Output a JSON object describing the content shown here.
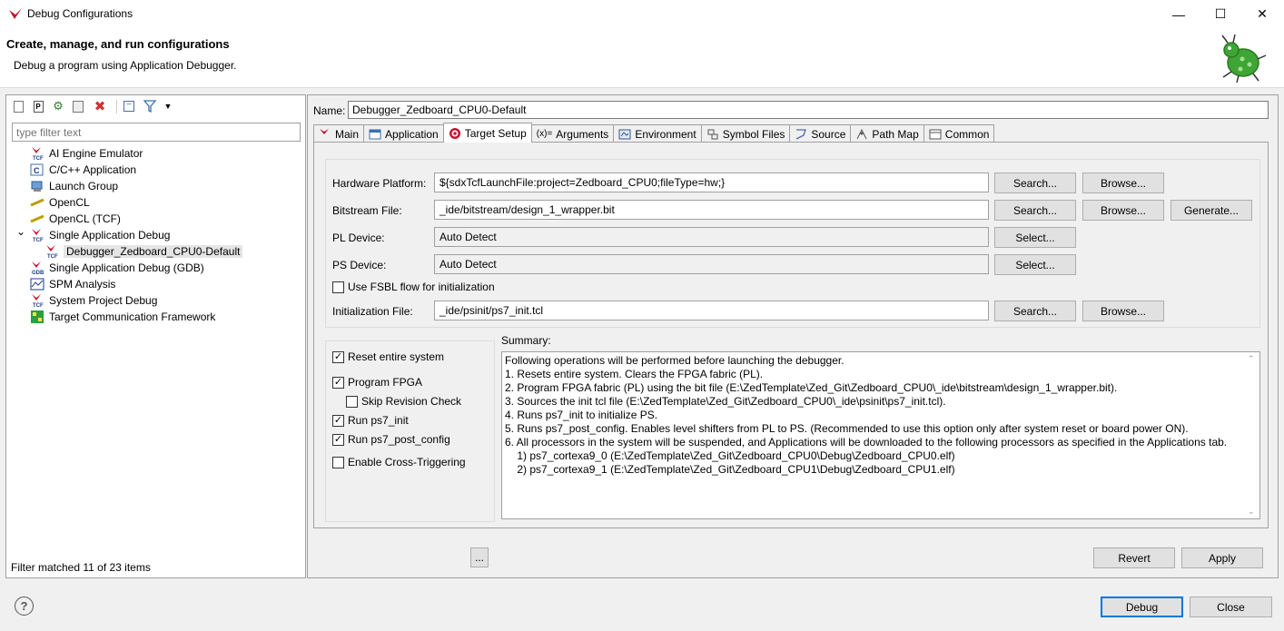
{
  "window": {
    "title": "Debug Configurations",
    "minimize_glyph": "—",
    "maximize_glyph": "☐",
    "close_glyph": "✕"
  },
  "header": {
    "title": "Create, manage, and run configurations",
    "subtitle": "Debug a program using Application Debugger."
  },
  "left": {
    "filter_placeholder": "type filter text",
    "toolbar_icons": [
      "new-config-icon",
      "new-prototype-icon",
      "export-icon",
      "duplicate-icon",
      "delete-icon",
      "collapse-all-icon",
      "filter-icon",
      "view-menu-icon"
    ],
    "tree": [
      {
        "label": "AI Engine Emulator",
        "icon": "tcf-icon",
        "indent": 0
      },
      {
        "label": "C/C++ Application",
        "icon": "c-app-icon",
        "indent": 0
      },
      {
        "label": "Launch Group",
        "icon": "launch-group-icon",
        "indent": 0
      },
      {
        "label": "OpenCL",
        "icon": "opencl-icon",
        "indent": 0
      },
      {
        "label": "OpenCL (TCF)",
        "icon": "opencl-tcf-icon",
        "indent": 0
      },
      {
        "label": "Single Application Debug",
        "icon": "tcf-icon",
        "indent": 0,
        "expanded": true
      },
      {
        "label": "Debugger_Zedboard_CPU0-Default",
        "icon": "tcf-icon",
        "indent": 1,
        "selected": true
      },
      {
        "label": "Single Application Debug (GDB)",
        "icon": "gdb-icon",
        "indent": 0
      },
      {
        "label": "SPM Analysis",
        "icon": "spm-icon",
        "indent": 0
      },
      {
        "label": "System Project Debug",
        "icon": "tcf-icon",
        "indent": 0
      },
      {
        "label": "Target Communication Framework",
        "icon": "tcf-framework-icon",
        "indent": 0
      }
    ],
    "status": "Filter matched 11 of 23 items"
  },
  "right": {
    "name_label": "Name:",
    "name_value": "Debugger_Zedboard_CPU0-Default",
    "tabs": [
      {
        "label": "Main",
        "icon": "main-tab-icon"
      },
      {
        "label": "Application",
        "icon": "application-tab-icon"
      },
      {
        "label": "Target Setup",
        "icon": "target-tab-icon",
        "active": true
      },
      {
        "label": "Arguments",
        "icon": "arguments-tab-icon",
        "glyph": "(x)="
      },
      {
        "label": "Environment",
        "icon": "environment-tab-icon"
      },
      {
        "label": "Symbol Files",
        "icon": "symbol-files-tab-icon"
      },
      {
        "label": "Source",
        "icon": "source-tab-icon"
      },
      {
        "label": "Path Map",
        "icon": "path-map-tab-icon"
      },
      {
        "label": "Common",
        "icon": "common-tab-icon"
      }
    ],
    "fields": {
      "hardware_platform_label": "Hardware Platform:",
      "hardware_platform_value": "${sdxTcfLaunchFile:project=Zedboard_CPU0;fileType=hw;}",
      "bitstream_label": "Bitstream File:",
      "bitstream_value": "_ide/bitstream/design_1_wrapper.bit",
      "pl_device_label": "PL Device:",
      "pl_device_value": "Auto Detect",
      "ps_device_label": "PS Device:",
      "ps_device_value": "Auto Detect",
      "fsbl_label": "Use FSBL flow for initialization",
      "init_file_label": "Initialization File:",
      "init_file_value": "_ide/psinit/ps7_init.tcl"
    },
    "buttons": {
      "search": "Search...",
      "browse": "Browse...",
      "generate": "Generate...",
      "select": "Select...",
      "ellipsis": "..."
    },
    "options": [
      {
        "label": "Reset entire system",
        "checked": true
      },
      {
        "label": "Program FPGA",
        "checked": true
      },
      {
        "label": "Skip Revision Check",
        "checked": false
      },
      {
        "label": "Run ps7_init",
        "checked": true
      },
      {
        "label": "Run ps7_post_config",
        "checked": true
      },
      {
        "label": "Enable Cross-Triggering",
        "checked": false
      }
    ],
    "summary_label": "Summary:",
    "summary_lines": [
      "Following operations will be performed before launching the debugger.",
      "1. Resets entire system. Clears the FPGA fabric (PL).",
      "2. Program FPGA fabric (PL) using the bit file (E:\\ZedTemplate\\Zed_Git\\Zedboard_CPU0\\_ide\\bitstream\\design_1_wrapper.bit).",
      "3. Sources the init tcl file (E:\\ZedTemplate\\Zed_Git\\Zedboard_CPU0\\_ide\\psinit\\ps7_init.tcl).",
      "4. Runs ps7_init to initialize PS.",
      "5. Runs ps7_post_config. Enables level shifters from PL to PS. (Recommended to use this option only after system reset or board power ON).",
      "6. All processors in the system will be suspended, and Applications will be downloaded to the following processors as specified in the Applications tab.",
      "    1) ps7_cortexa9_0 (E:\\ZedTemplate\\Zed_Git\\Zedboard_CPU0\\Debug\\Zedboard_CPU0.elf)",
      "    2) ps7_cortexa9_1 (E:\\ZedTemplate\\Zed_Git\\Zedboard_CPU1\\Debug\\Zedboard_CPU1.elf)"
    ],
    "revert": "Revert",
    "apply": "Apply"
  },
  "footer": {
    "debug": "Debug",
    "close": "Close",
    "help_glyph": "?"
  },
  "colors": {
    "accent": "#0078d7",
    "xilinx_red": "#c8102e",
    "bug_green": "#3fa535"
  }
}
